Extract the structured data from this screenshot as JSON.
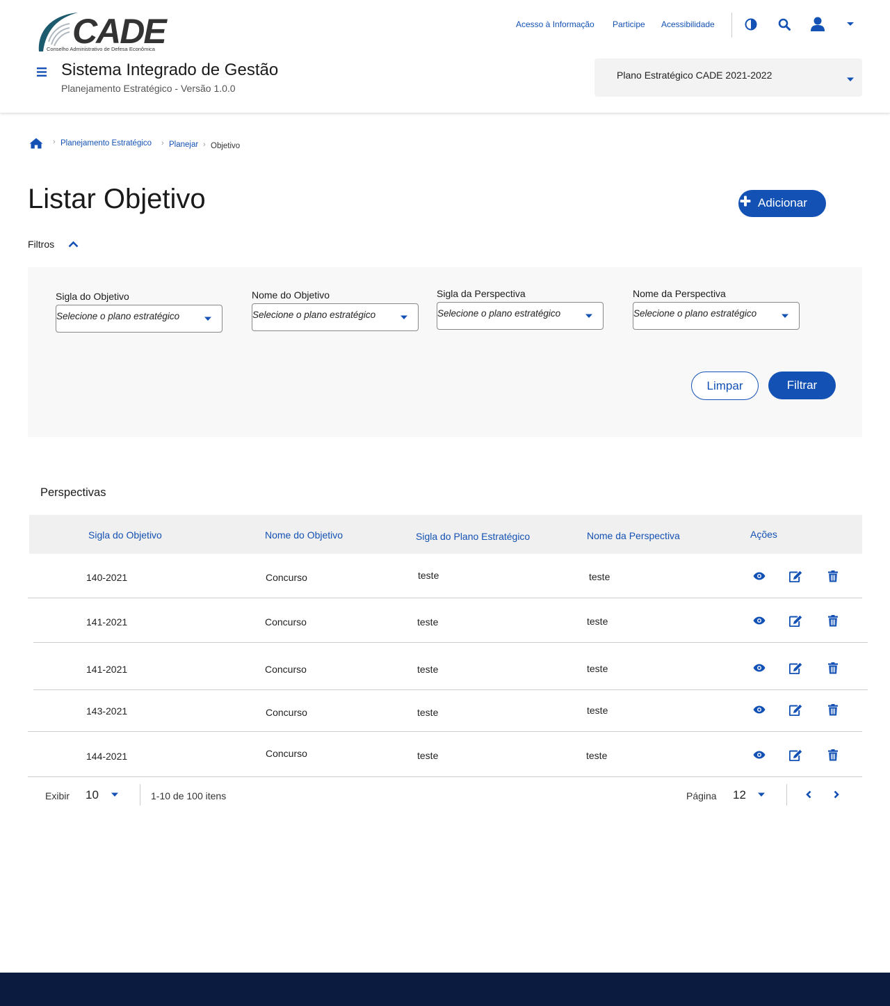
{
  "brand": {
    "logo_word": "CADE",
    "logo_subtitle": "Conselho Administrativo de Defesa Econômica"
  },
  "top_links": [
    "Acesso à Informação",
    "Participe",
    "Acessibilidade"
  ],
  "system": {
    "title": "Sistema Integrado de Gestão",
    "subtitle": "Planejamento Estratégico - Versão 1.0.0"
  },
  "plan_select": {
    "value": "Plano Estratégico CADE 2021-2022"
  },
  "breadcrumb": [
    "Planejamento Estratégico",
    "Planejar",
    "Objetivo"
  ],
  "page": {
    "title": "Listar Objetivo",
    "add_label": "Adicionar"
  },
  "filters": {
    "toggle_label": "Filtros",
    "fields": [
      {
        "label": "Sigla do Objetivo",
        "placeholder": "Selecione o plano estratégico"
      },
      {
        "label": "Nome do Objetivo",
        "placeholder": "Selecione o plano estratégico"
      },
      {
        "label": "Sigla da Perspectiva",
        "placeholder": "Selecione o plano estratégico"
      },
      {
        "label": "Nome da Perspectiva",
        "placeholder": "Selecione o plano estratégico"
      }
    ],
    "clear_label": "Limpar",
    "filter_label": "Filtrar"
  },
  "table": {
    "title": "Perspectivas",
    "columns": [
      "Sigla do Objetivo",
      "Nome do Objetivo",
      "Sigla do Plano Estratégico",
      "Nome da Perspectiva",
      "Ações"
    ],
    "rows": [
      [
        "140-2021",
        "Concurso",
        "teste",
        "teste"
      ],
      [
        "141-2021",
        "Concurso",
        "teste",
        "teste"
      ],
      [
        "141-2021",
        "Concurso",
        "teste",
        "teste"
      ],
      [
        "143-2021",
        "Concurso",
        "teste",
        "teste"
      ],
      [
        "144-2021",
        "Concurso",
        "teste",
        "teste"
      ]
    ]
  },
  "pagination": {
    "show_label": "Exibir",
    "page_size": "10",
    "range_text": "1-10 de 100 itens",
    "page_label": "Página",
    "current_page": "12"
  },
  "colors": {
    "accent": "#1351b4",
    "footer": "#0b1b3f",
    "filter_bg": "#f8f8f8",
    "table_header_bg": "#f0f0f0"
  },
  "icons": [
    "menu-icon",
    "contrast-icon",
    "search-icon",
    "user-icon",
    "caret-down-icon",
    "home-icon",
    "chevron-up-icon",
    "plus-icon",
    "eye-icon",
    "edit-icon",
    "trash-icon",
    "chevron-left-icon",
    "chevron-right-icon"
  ]
}
